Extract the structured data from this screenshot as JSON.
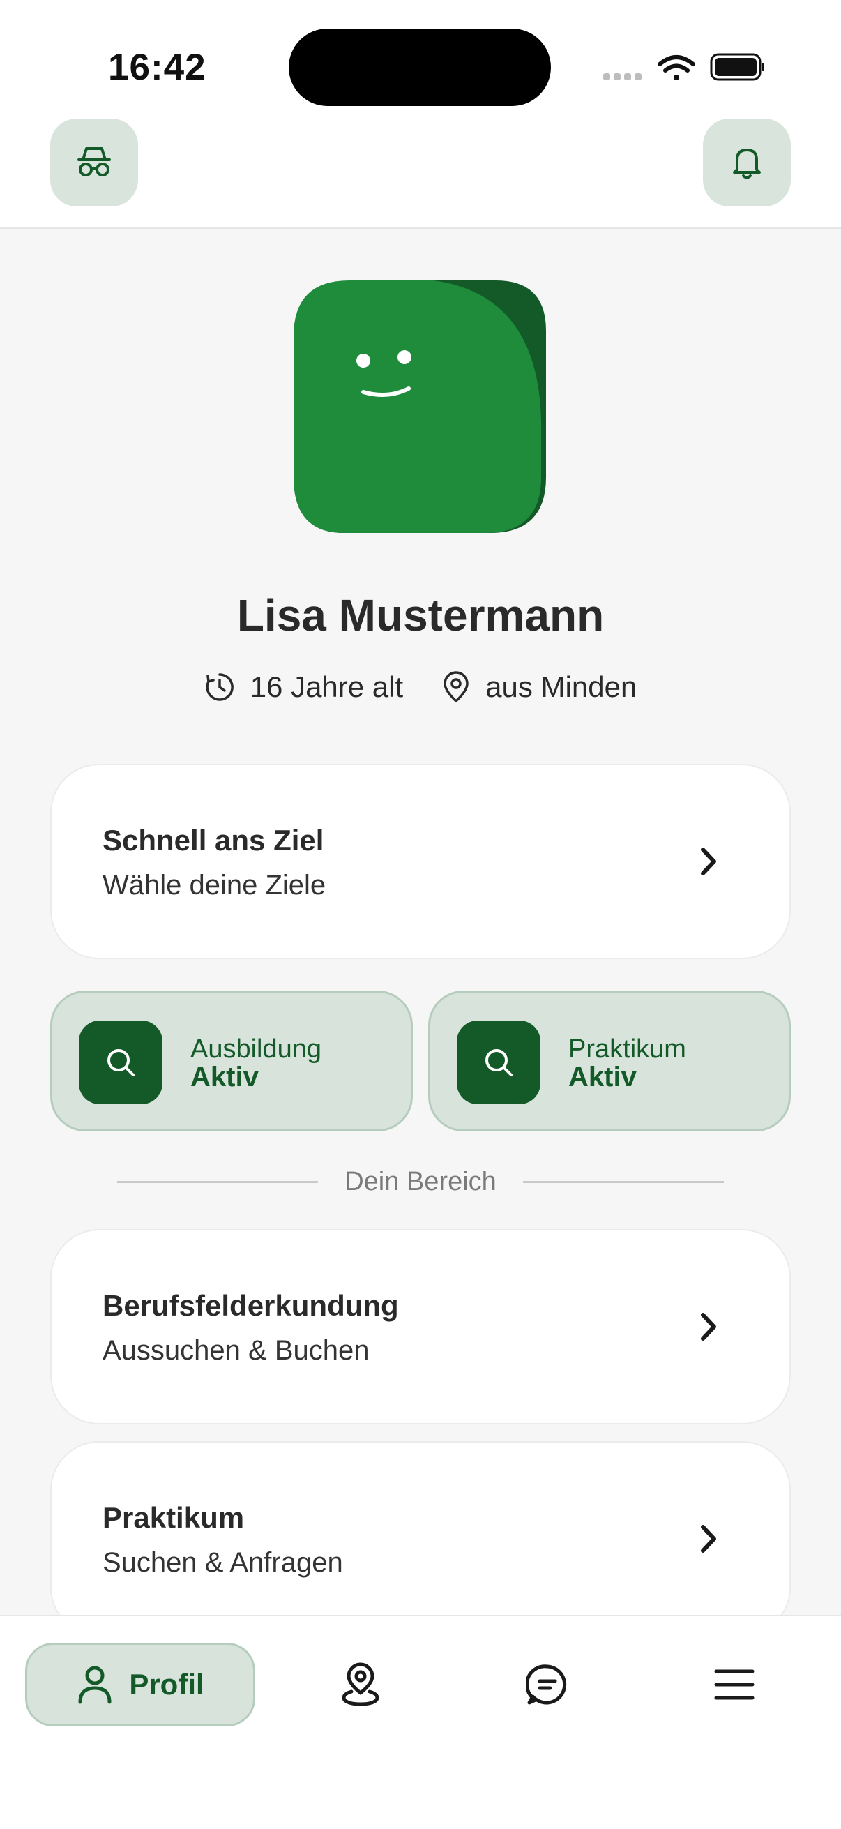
{
  "status_bar": {
    "time": "16:42",
    "icons": [
      "signal-icon",
      "wifi-icon",
      "battery-icon"
    ]
  },
  "top_bar": {
    "left_icon": "incognito-icon",
    "right_icon": "bell-icon"
  },
  "profile": {
    "avatar_icon": "smiley-avatar-icon",
    "name": "Lisa Mustermann",
    "age": "16 Jahre alt",
    "location": "aus Minden"
  },
  "quick_goal": {
    "title": "Schnell ans Ziel",
    "subtitle": "Wähle deine Ziele"
  },
  "search_status": [
    {
      "label": "Ausbildung",
      "state": "Aktiv",
      "icon": "search-icon"
    },
    {
      "label": "Praktikum",
      "state": "Aktiv",
      "icon": "search-icon"
    }
  ],
  "section_label": "Dein Bereich",
  "area_cards": [
    {
      "title": "Berufsfelderkundung",
      "subtitle": "Aussuchen & Buchen"
    },
    {
      "title": "Praktikum",
      "subtitle": "Suchen & Anfragen"
    }
  ],
  "bottom_nav": {
    "profile_label": "Profil",
    "items": [
      "person-icon",
      "map-pin-icon",
      "chat-icon",
      "menu-icon"
    ]
  },
  "colors": {
    "brand_dark": "#145a28",
    "brand": "#1e8c3a",
    "pill_bg": "#d7e3db",
    "background": "#f6f6f6"
  }
}
